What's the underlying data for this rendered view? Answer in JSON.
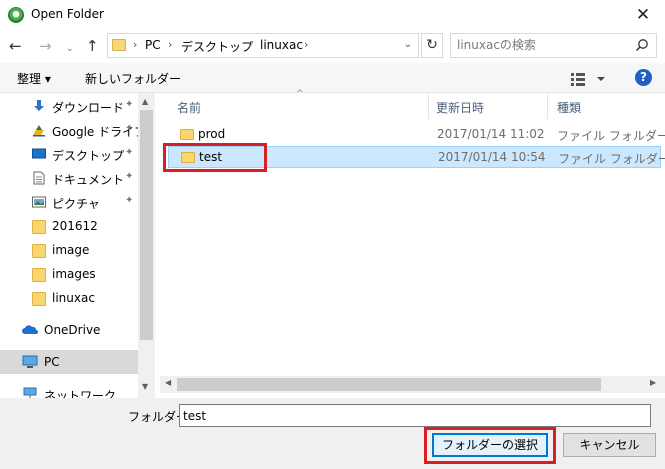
{
  "window": {
    "title": "Open Folder",
    "close_glyph": "✕"
  },
  "nav": {
    "back_glyph": "←",
    "forward_glyph": "→",
    "recent_glyph": "⌄",
    "up_glyph": "↑",
    "breadcrumb": [
      "PC",
      "デスクトップ",
      "linuxac"
    ],
    "sep_glyph": "›",
    "dropdown_glyph": "⌄",
    "refresh_glyph": "↻",
    "search_placeholder": "linuxacの検索"
  },
  "toolbar": {
    "organize_label": "整理 ▾",
    "new_folder_label": "新しいフォルダー",
    "help_label": "?"
  },
  "sidebar": {
    "items": [
      {
        "label": "ダウンロード",
        "icon": "download-icon",
        "pinned": true
      },
      {
        "label": "Google ドライブ",
        "icon": "google-drive-icon",
        "pinned": true
      },
      {
        "label": "デスクトップ",
        "icon": "desktop-icon",
        "pinned": true
      },
      {
        "label": "ドキュメント",
        "icon": "documents-icon",
        "pinned": true
      },
      {
        "label": "ピクチャ",
        "icon": "pictures-icon",
        "pinned": true
      },
      {
        "label": "201612",
        "icon": "folder-icon",
        "pinned": false
      },
      {
        "label": "image",
        "icon": "folder-icon",
        "pinned": false
      },
      {
        "label": "images",
        "icon": "folder-icon",
        "pinned": false
      },
      {
        "label": "linuxac",
        "icon": "folder-icon",
        "pinned": false
      },
      {
        "label": "OneDrive",
        "icon": "onedrive-icon",
        "pinned": false
      },
      {
        "label": "PC",
        "icon": "pc-icon",
        "pinned": false,
        "selected": true
      },
      {
        "label": "ネットワーク",
        "icon": "network-icon",
        "pinned": false
      }
    ],
    "pin_glyph": "📌"
  },
  "files": {
    "columns": [
      "名前",
      "更新日時",
      "種類"
    ],
    "sort_glyph": "^",
    "rows": [
      {
        "name": "prod",
        "date": "2017/01/14 11:02",
        "type": "ファイル フォルダー",
        "selected": false
      },
      {
        "name": "test",
        "date": "2017/01/14 10:54",
        "type": "ファイル フォルダー",
        "selected": true
      }
    ]
  },
  "footer": {
    "folder_label": "フォルダー:",
    "folder_value": "test",
    "select_button": "フォルダーの選択",
    "cancel_button": "キャンセル"
  },
  "colors": {
    "selection_bg": "#cce8ff",
    "highlight_red": "#d81f26",
    "accent_blue": "#0078d7"
  }
}
